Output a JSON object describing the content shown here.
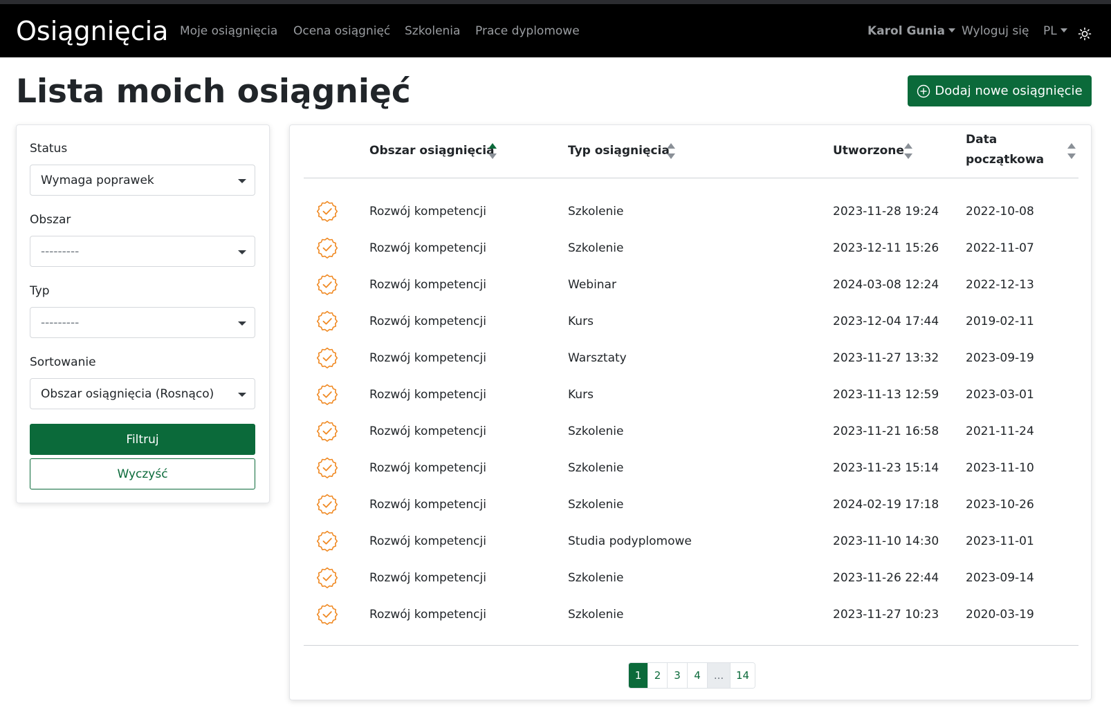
{
  "navbar": {
    "brand": "Osiągnięcia",
    "links": [
      "Moje osiągnięcia",
      "Ocena osiągnięć",
      "Szkolenia",
      "Prace dyplomowe"
    ],
    "user": "Karol Gunia",
    "logout": "Wyloguj się",
    "language": "PL",
    "theme_icon": "sun-icon"
  },
  "page": {
    "title": "Lista moich osiągnięć",
    "add_button": "Dodaj nowe osiągnięcie"
  },
  "filters": {
    "status_label": "Status",
    "status_value": "Wymaga poprawek",
    "area_label": "Obszar",
    "area_value": "---------",
    "type_label": "Typ",
    "type_value": "---------",
    "sort_label": "Sortowanie",
    "sort_value": "Obszar osiągnięcia (Rosnąco)",
    "filter_button": "Filtruj",
    "clear_button": "Wyczyść"
  },
  "table": {
    "headers": {
      "area": "Obszar osiągnięcia",
      "type": "Typ osiągnięcia",
      "created": "Utworzone",
      "start_line1": "Data",
      "start_line2": "początkowa"
    },
    "status_icon": "badge-check-icon",
    "rows": [
      {
        "area": "Rozwój kompetencji",
        "type": "Szkolenie",
        "created": "2023-11-28 19:24",
        "start": "2022-10-08"
      },
      {
        "area": "Rozwój kompetencji",
        "type": "Szkolenie",
        "created": "2023-12-11 15:26",
        "start": "2022-11-07"
      },
      {
        "area": "Rozwój kompetencji",
        "type": "Webinar",
        "created": "2024-03-08 12:24",
        "start": "2022-12-13"
      },
      {
        "area": "Rozwój kompetencji",
        "type": "Kurs",
        "created": "2023-12-04 17:44",
        "start": "2019-02-11"
      },
      {
        "area": "Rozwój kompetencji",
        "type": "Warsztaty",
        "created": "2023-11-27 13:32",
        "start": "2023-09-19"
      },
      {
        "area": "Rozwój kompetencji",
        "type": "Kurs",
        "created": "2023-11-13 12:59",
        "start": "2023-03-01"
      },
      {
        "area": "Rozwój kompetencji",
        "type": "Szkolenie",
        "created": "2023-11-21 16:58",
        "start": "2021-11-24"
      },
      {
        "area": "Rozwój kompetencji",
        "type": "Szkolenie",
        "created": "2023-11-23 15:14",
        "start": "2023-11-10"
      },
      {
        "area": "Rozwój kompetencji",
        "type": "Szkolenie",
        "created": "2024-02-19 17:18",
        "start": "2023-10-26"
      },
      {
        "area": "Rozwój kompetencji",
        "type": "Studia podyplomowe",
        "created": "2023-11-10 14:30",
        "start": "2023-11-01"
      },
      {
        "area": "Rozwój kompetencji",
        "type": "Szkolenie",
        "created": "2023-11-26 22:44",
        "start": "2023-09-14"
      },
      {
        "area": "Rozwój kompetencji",
        "type": "Szkolenie",
        "created": "2023-11-27 10:23",
        "start": "2020-03-19"
      }
    ]
  },
  "pagination": [
    "1",
    "2",
    "3",
    "4",
    "...",
    "14"
  ],
  "colors": {
    "accent": "#0b6a3a",
    "navbar": "#000000",
    "badge": "#f08a24"
  }
}
